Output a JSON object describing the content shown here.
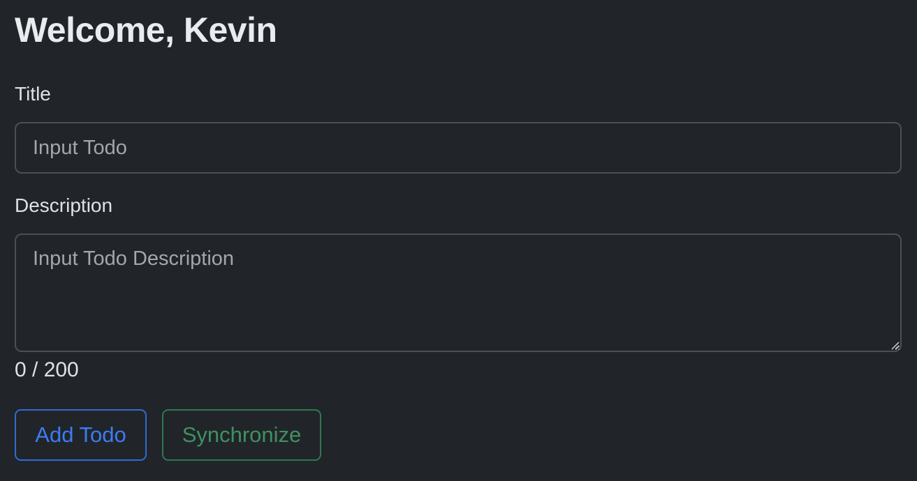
{
  "header": {
    "title": "Welcome, Kevin"
  },
  "form": {
    "title_label": "Title",
    "title_placeholder": "Input Todo",
    "title_value": "",
    "description_label": "Description",
    "description_placeholder": "Input Todo Description",
    "description_value": "",
    "char_counter": "0 / 200"
  },
  "actions": {
    "add_label": "Add Todo",
    "sync_label": "Synchronize"
  },
  "colors": {
    "background": "#212529",
    "primary": "#3d7bf4",
    "success": "#3f9161"
  }
}
